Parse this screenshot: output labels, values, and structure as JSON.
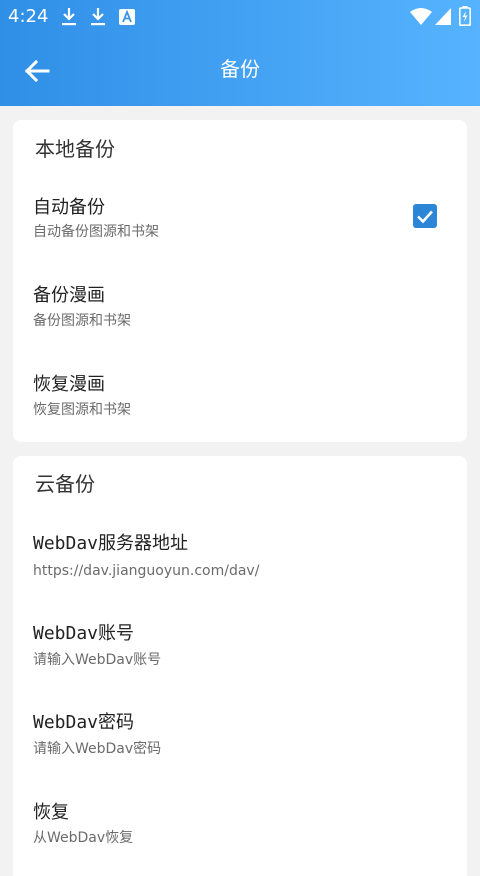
{
  "status_bar": {
    "time": "4:24"
  },
  "toolbar": {
    "title": "备份",
    "back_icon": "arrow-left-icon"
  },
  "local_backup": {
    "section_title": "本地备份",
    "items": [
      {
        "title": "自动备份",
        "subtitle": "自动备份图源和书架",
        "checked": true
      },
      {
        "title": "备份漫画",
        "subtitle": "备份图源和书架"
      },
      {
        "title": "恢复漫画",
        "subtitle": "恢复图源和书架"
      }
    ]
  },
  "cloud_backup": {
    "section_title": "云备份",
    "items": [
      {
        "title": "WebDav服务器地址",
        "subtitle": "https://dav.jianguoyun.com/dav/"
      },
      {
        "title": "WebDav账号",
        "subtitle": "请输入WebDav账号"
      },
      {
        "title": "WebDav密码",
        "subtitle": "请输入WebDav密码"
      },
      {
        "title": "恢复",
        "subtitle": "从WebDav恢复"
      }
    ]
  },
  "colors": {
    "appbar_start": "#2f8fe6",
    "appbar_end": "#56b3ff",
    "checkbox": "#2b86d8",
    "background": "#f2f2f2"
  }
}
